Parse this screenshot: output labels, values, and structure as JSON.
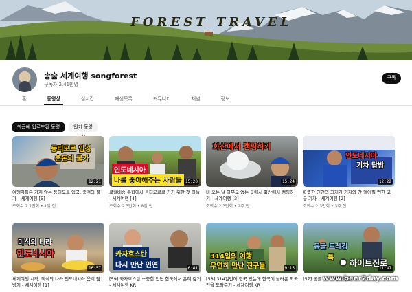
{
  "banner": {
    "title": "FOREST TRAVEL"
  },
  "channel": {
    "name": "송숲 세계여행 songforest",
    "subscribers": "구독자 2.41만명",
    "subscribe_label": "구독"
  },
  "tabs": [
    "홈",
    "동영상",
    "실시간",
    "재생목록",
    "커뮤니티",
    "채널",
    "정보"
  ],
  "active_tab": "동영상",
  "chips": {
    "recent": "최근에 업로드된 동영상",
    "popular": "인기 동영상"
  },
  "videos": [
    {
      "overlay1": "동티모르 입성",
      "overlay2": "흔돈의 물가",
      "duration": "12:21",
      "title": "여행자들은 가지 않는 동티모르 입국, 충격의 물가 - 세계여행 [5]",
      "meta": "조회수 2.2만회 • 1일 전"
    },
    {
      "overlay1": "인도네시아",
      "overlay2": "나를 좋아해주는 사람들",
      "duration": "15:20",
      "title": "로컬배송 투합에서 동티모르로 가기 위한 첫 하늘 - 세계여행 [4]",
      "meta": "조회수 2.3만회 • 8일 전"
    },
    {
      "overlay1": "화산에서 캠핑하기",
      "overlay2": "",
      "duration": "15:24",
      "title": "비 오는 날 아무도 없는 곳에서 화산에서 캠핑하기 - 세계여행 [3]",
      "meta": "조회수 2.3만회 • 2주 전"
    },
    {
      "overlay1": "인도네시아",
      "overlay2": "기차 탑방",
      "duration": "12:22",
      "title": "따뜻한 인연의 최저가 기차와 간 멜어질 뻔한 고급 기차 - 세계여행 [2]",
      "meta": "조회수 2.3만회 • 3주 전"
    },
    {
      "overlay1": "미식의 나라",
      "overlay2": "인도네시아",
      "duration": "16:57",
      "title": "세계여행 시작, 미식의 나라 인도네시아 음식 탐방기 - 세계여행 [1]",
      "meta": ""
    },
    {
      "overlay1": "카자흐스탄",
      "overlay2": "다시 만난 인연",
      "duration": "6:41",
      "title": "[59] 카자흐스탄 소중한 인연 한국에서 은혜 갚기 - 세계여행 KR",
      "meta": ""
    },
    {
      "overlay1": "314일의 여행",
      "overlay2": "우연히 만난 친구들",
      "duration": "9:15",
      "title": "[58] 314일만에 한국 왔는데 한국에 놀러온 외국인을 도와주기 - 세계여행 KR",
      "meta": ""
    },
    {
      "overlay1": "몽골 트레킹",
      "overlay2": "특",
      "duration": "11:47",
      "title": "[57] 몽골 호 ... 세계여행 MN",
      "meta": ""
    }
  ],
  "watermark": {
    "logo": "하이트진로",
    "url": "www.beer2day.com"
  }
}
